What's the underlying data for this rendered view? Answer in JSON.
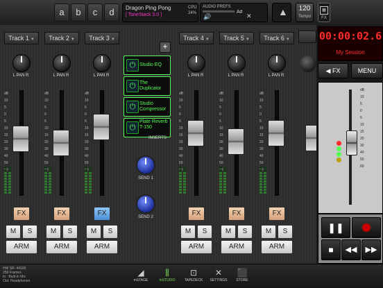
{
  "topbar": {
    "tracks": [
      "a",
      "b",
      "c",
      "d"
    ],
    "song_name": "Dragon Ping Pong",
    "song_sub": "[ ToneStack 3.0 ]",
    "cpu_label": "CPU",
    "cpu_value": "24%",
    "audio_prefs": "AUDIO PREFS",
    "key": "A#",
    "tempo": "120",
    "tempo_label": "Tempo",
    "fx_label": "FX"
  },
  "mixer": {
    "strips": [
      {
        "name": "Track 1",
        "pan": "PAN",
        "fx": "FX",
        "mute": "M",
        "solo": "S",
        "arm": "ARM",
        "fader_level": 0.55,
        "fx_on": false
      },
      {
        "name": "Track 2",
        "pan": "PAN",
        "fx": "FX",
        "mute": "M",
        "solo": "S",
        "arm": "ARM",
        "fader_level": 0.5,
        "fx_on": false
      },
      {
        "name": "Track 3",
        "pan": "PAN",
        "fx": "FX",
        "mute": "M",
        "solo": "S",
        "arm": "ARM",
        "fader_level": 0.7,
        "fx_on": true
      },
      {
        "name": "Track 4",
        "pan": "PAN",
        "fx": "FX",
        "mute": "M",
        "solo": "S",
        "arm": "ARM",
        "fader_level": 0.62,
        "fx_on": false
      },
      {
        "name": "Track 5",
        "pan": "PAN",
        "fx": "FX",
        "mute": "M",
        "solo": "S",
        "arm": "ARM",
        "fader_level": 0.52,
        "fx_on": false
      },
      {
        "name": "Track 6",
        "pan": "PAN",
        "fx": "FX",
        "mute": "M",
        "solo": "S",
        "arm": "ARM",
        "fader_level": 0.62,
        "fx_on": false
      }
    ],
    "pan_left": "L",
    "pan_right": "R",
    "db_scale": [
      "dB",
      "10",
      "5",
      "0",
      "5",
      "10",
      "15",
      "20",
      "30",
      "40",
      "50",
      "60"
    ],
    "inserts": [
      "Studio EQ",
      "The Duplicator",
      "Studio Compressor",
      "Plate Reverb T-150"
    ],
    "inserts_label": "INSERTS",
    "add_label": "+",
    "send1_label": "SEND 1",
    "send2_label": "SEND 2"
  },
  "master": {
    "time": "00:00:02.6",
    "session": "My Session",
    "fx_label": "FX",
    "menu_label": "MENU",
    "fader_level": 0.55
  },
  "footer": {
    "info": [
      "HW SR: 44100",
      "256 Frames",
      "In : Built-In Mic",
      "Out: Headphones"
    ],
    "nav": [
      {
        "label": "mSTAGE",
        "icon": "stage-icon"
      },
      {
        "label": "mSTUDIO",
        "icon": "mixer-icon"
      },
      {
        "label": "TAPEDECK",
        "icon": "tapedeck-icon"
      },
      {
        "label": "SETTINGS",
        "icon": "settings-icon"
      },
      {
        "label": "STORE",
        "icon": "store-icon"
      }
    ]
  },
  "colors": {
    "accent_green": "#55ff55",
    "led_red": "#ff2a2a",
    "fx_on_blue": "#5ba0e8"
  }
}
